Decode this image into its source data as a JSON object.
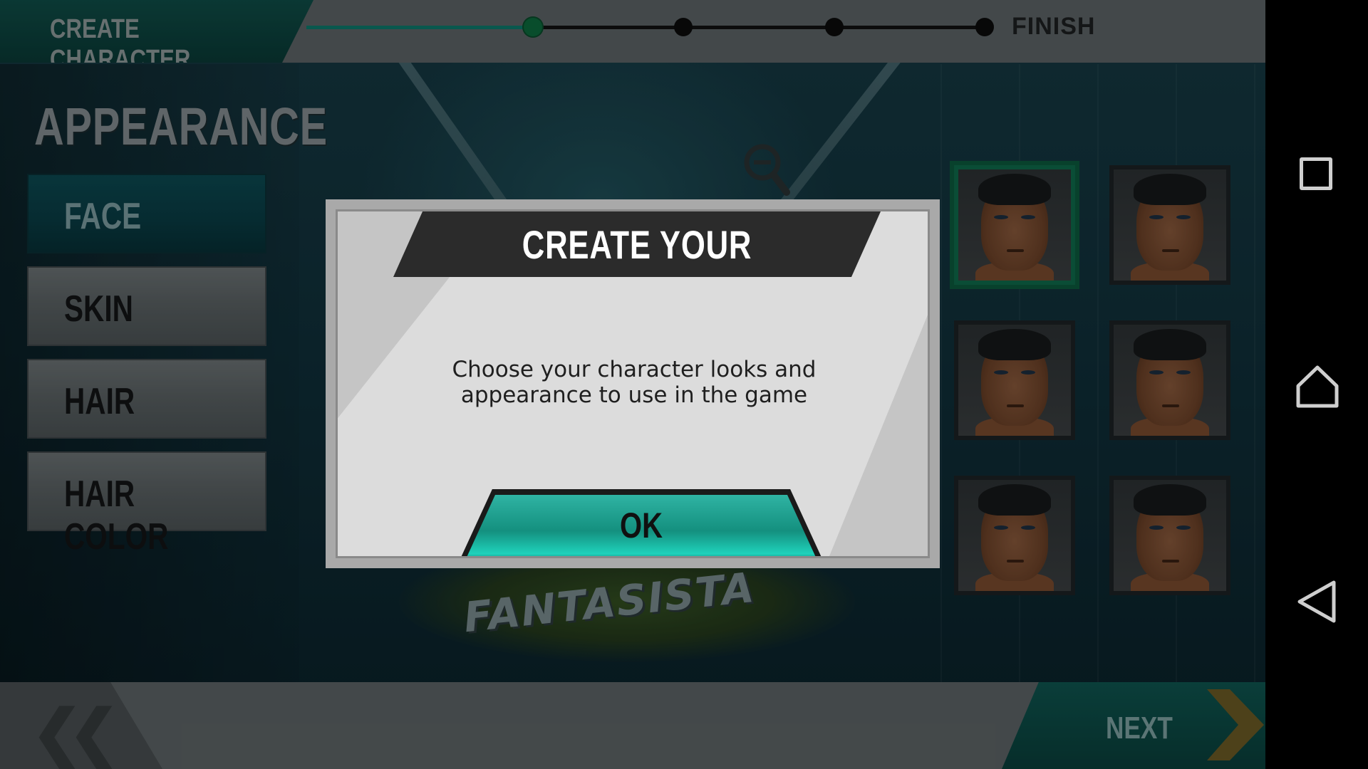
{
  "header": {
    "tab_label": "CREATE CHARACTER",
    "steps_total": 4,
    "current_step": 1,
    "finish_label": "FINISH"
  },
  "sidebar": {
    "section_title": "APPEARANCE",
    "items": [
      {
        "label": "FACE",
        "active": true
      },
      {
        "label": "SKIN",
        "active": false
      },
      {
        "label": "HAIR",
        "active": false
      },
      {
        "label": "HAIR COLOR",
        "active": false
      }
    ]
  },
  "faces": {
    "count": 6,
    "selected_index": 0
  },
  "background": {
    "logo_text": "FANTASISTA"
  },
  "dialog": {
    "title": "CREATE YOUR CHARACTER",
    "message_line1": "Choose your character looks and",
    "message_line2": "appearance to use in the game",
    "ok_label": "OK"
  },
  "footer": {
    "back_icon": "double-chevron-left-icon",
    "next_label": "NEXT",
    "next_icon": "chevron-right-icon"
  },
  "system_nav": {
    "icons": [
      "recent-apps-icon",
      "home-icon",
      "back-icon"
    ]
  },
  "colors": {
    "accent_teal": "#14907f",
    "selected_green": "#0f6b4b",
    "bar_gray": "#5e6567",
    "active_tab": "#0f4e48"
  }
}
